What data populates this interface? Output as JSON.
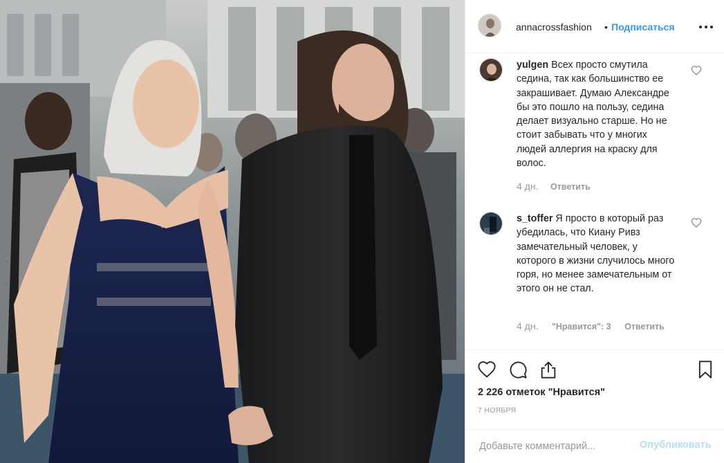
{
  "post": {
    "author": "annacrossfashion",
    "separator": "•",
    "follow_label": "Подписаться",
    "more_icon": "more-horizontal-icon"
  },
  "comments": [
    {
      "username": "yulgen",
      "text": "Всех просто смутила седина, так как большинство ее закрашивает. Думаю Александре бы это пошло на пользу, седина делает визуально старше. Но не стоит забывать что у многих людей аллергия на краску для волос.",
      "age": "4 дн.",
      "likes": "",
      "reply_label": "Ответить"
    },
    {
      "username": "s_toffer",
      "text": "Я просто в который раз убедилась, что Киану Ривз замечательный человек, у которого в жизни случилось много горя, но менее замечательным от этого он не стал.",
      "age": "4 дн.",
      "likes": "\"Нравится\": 3",
      "reply_label": "Ответить"
    }
  ],
  "actions": {
    "likes_count": "2 226 отметок \"Нравится\"",
    "date": "7 НОЯБРЯ",
    "icons": [
      "heart-icon",
      "comment-icon",
      "share-icon",
      "bookmark-icon"
    ]
  },
  "composer": {
    "placeholder": "Добавьте комментарий...",
    "publish_label": "Опубликовать"
  },
  "colors": {
    "link": "#3897f0",
    "publish_disabled": "#b2dffc",
    "muted": "#999999",
    "text": "#262626"
  }
}
